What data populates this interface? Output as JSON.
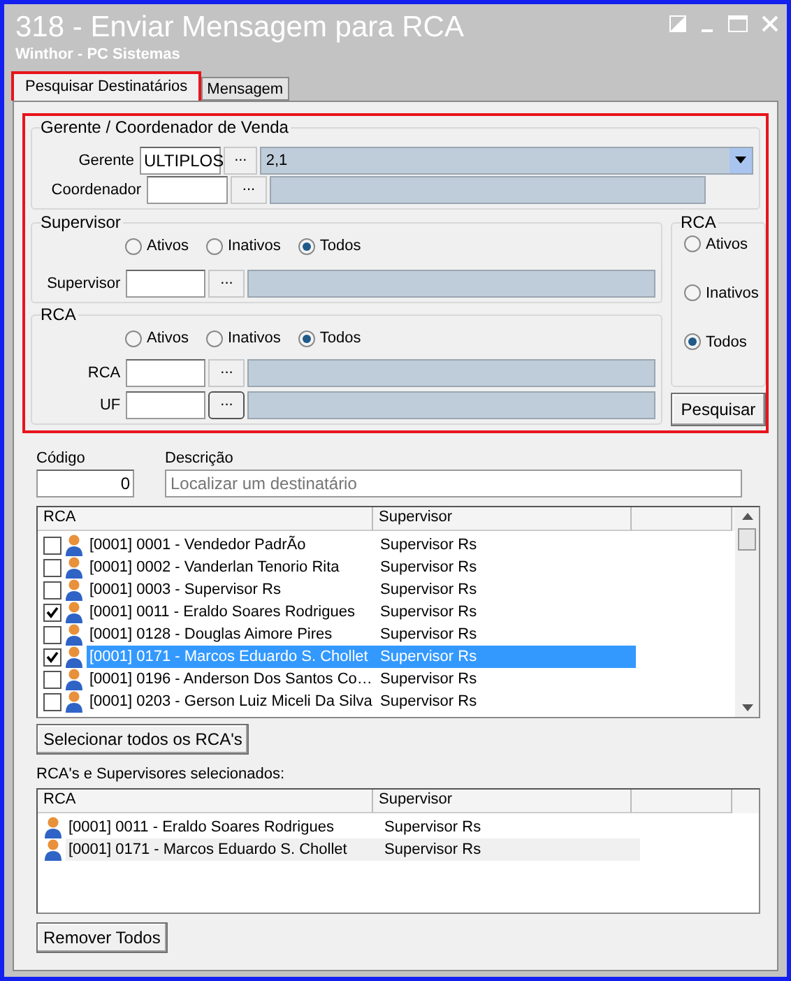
{
  "window": {
    "title": "318 - Enviar Mensagem para RCA",
    "subtitle": "Winthor - PC Sistemas"
  },
  "tabs": [
    {
      "label": "Pesquisar Destinatários",
      "selected": true,
      "highlighted": true
    },
    {
      "label": "Mensagem",
      "selected": false,
      "highlighted": false
    }
  ],
  "filter_panel": {
    "highlighted": true
  },
  "gerente_group": {
    "title": "Gerente / Coordenador de Venda",
    "gerente": {
      "label": "Gerente",
      "code": "ULTIPLOS",
      "button": "...",
      "description": "2,1"
    },
    "coordenador": {
      "label": "Coordenador",
      "button": "..."
    }
  },
  "supervisor_group": {
    "title": "Supervisor",
    "options": [
      {
        "label": "Ativos",
        "selected": false
      },
      {
        "label": "Inativos",
        "selected": false
      },
      {
        "label": "Todos",
        "selected": true
      }
    ],
    "field_label": "Supervisor",
    "button": "..."
  },
  "rca_group": {
    "title": "RCA",
    "options": [
      {
        "label": "Ativos",
        "selected": false
      },
      {
        "label": "Inativos",
        "selected": false
      },
      {
        "label": "Todos",
        "selected": true
      }
    ],
    "fields": [
      {
        "label": "RCA",
        "button": "..."
      },
      {
        "label": "UF",
        "button": "..."
      }
    ]
  },
  "rca_status": {
    "title": "RCA",
    "options": [
      {
        "label": "Ativos",
        "selected": false
      },
      {
        "label": "Inativos",
        "selected": false
      },
      {
        "label": "Todos",
        "selected": true
      }
    ]
  },
  "search_button": "Pesquisar",
  "codigo": {
    "label": "Código",
    "value": "0"
  },
  "descricao": {
    "label": "Descrição",
    "placeholder": "Localizar um destinatário"
  },
  "rca_table": {
    "columns": [
      "RCA",
      "Supervisor"
    ],
    "rows": [
      {
        "rca": "[0001] 0001 - Vendedor PadrÃo",
        "supervisor": "Supervisor Rs",
        "checked": false,
        "selected": false
      },
      {
        "rca": "[0001] 0002 - Vanderlan Tenorio Rita",
        "supervisor": "Supervisor Rs",
        "checked": false,
        "selected": false
      },
      {
        "rca": "[0001] 0003 - Supervisor Rs",
        "supervisor": "Supervisor Rs",
        "checked": false,
        "selected": false
      },
      {
        "rca": "[0001] 0011 - Eraldo Soares Rodrigues",
        "supervisor": "Supervisor Rs",
        "checked": true,
        "selected": false
      },
      {
        "rca": "[0001] 0128 - Douglas Aimore Pires",
        "supervisor": "Supervisor Rs",
        "checked": false,
        "selected": false
      },
      {
        "rca": "[0001] 0171 - Marcos Eduardo S. Chollet",
        "supervisor": "Supervisor Rs",
        "checked": true,
        "selected": true
      },
      {
        "rca": "[0001] 0196 - Anderson Dos Santos Co…",
        "supervisor": "Supervisor Rs",
        "checked": false,
        "selected": false
      },
      {
        "rca": "[0001] 0203 - Gerson Luiz Miceli Da Silva",
        "supervisor": "Supervisor Rs",
        "checked": false,
        "selected": false
      }
    ]
  },
  "select_all_button": "Selecionar todos os RCA's",
  "selected_label": "RCA's e Supervisores selecionados:",
  "selected_table": {
    "columns": [
      "RCA",
      "Supervisor"
    ],
    "rows": [
      {
        "rca": "[0001] 0011 - Eraldo Soares Rodrigues",
        "supervisor": "Supervisor Rs",
        "selected": false
      },
      {
        "rca": "[0001] 0171 - Marcos Eduardo S. Chollet",
        "supervisor": "Supervisor Rs",
        "selected": true
      }
    ]
  },
  "remove_all_button": "Remover Todos"
}
